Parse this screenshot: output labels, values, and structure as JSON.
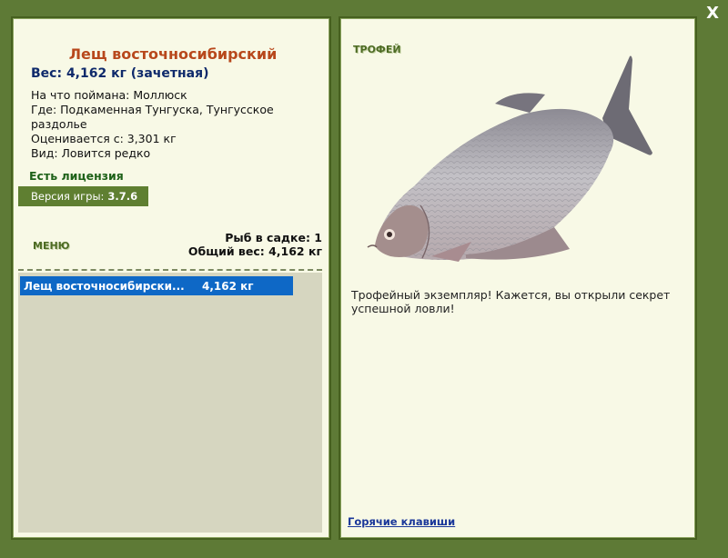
{
  "window": {
    "close_label": "X"
  },
  "fish": {
    "name": "Лещ восточносибирский",
    "weight": "Вес: 4,162 кг (зачетная)",
    "bait": "На что поймана: Моллюск",
    "location": "Где: Подкаменная Тунгуска, Тунгусское раздолье",
    "value": "Оценивается с: 3,301 кг",
    "rarity": "Вид: Ловится редко"
  },
  "license": "Есть лицензия",
  "version": {
    "label": "Версия игры:",
    "number": "3.7.6"
  },
  "menu_label": "МЕНЮ",
  "keepnet": {
    "count": "Рыб в садке: 1",
    "total": "Общий вес: 4,162 кг"
  },
  "catch_list": [
    {
      "name": "Лещ восточносибирски...",
      "weight": "4,162 кг"
    }
  ],
  "trophy": {
    "label": "ТРОФЕЙ",
    "description": "Трофейный экземпляр! Кажется, вы открыли секрет успешной ловли!",
    "image_icon": "bream-fish-image"
  },
  "hotkeys_link": "Горячие клавиши",
  "colors": {
    "background": "#5e7a36",
    "panel": "#f8f9e6",
    "title": "#b8481c",
    "weight": "#0f2a6b",
    "license": "#1e6118",
    "selection": "#0e68c6"
  }
}
